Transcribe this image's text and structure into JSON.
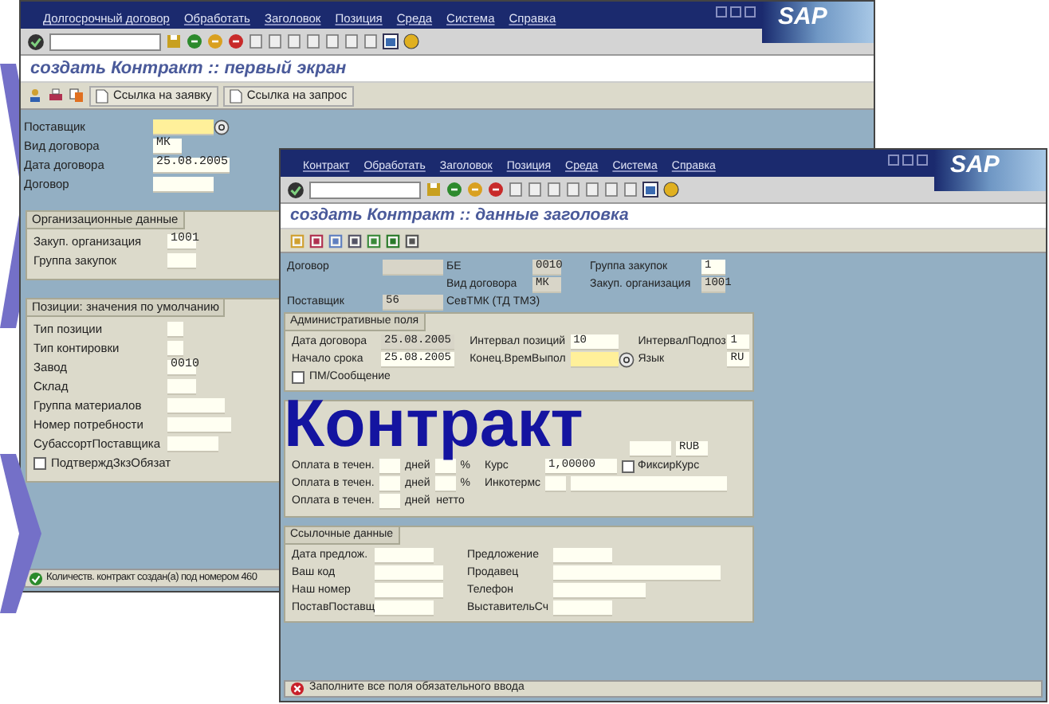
{
  "first_window": {
    "logo": "SAP",
    "menu": [
      "Долгосрочный договор",
      "Обработать",
      "Заголовок",
      "Позиция",
      "Среда",
      "Система",
      "Справка"
    ],
    "title": "создать Контракт :: первый экран",
    "app_buttons": [
      "Ссылка на заявку",
      "Ссылка на запрос"
    ],
    "header_fields": [
      {
        "label": "Поставщик",
        "kind": "required"
      },
      {
        "label": "Вид договора",
        "value": "МК",
        "kind": "input"
      },
      {
        "label": "Дата договора",
        "value": "25.08.2005",
        "kind": "input"
      },
      {
        "label": "Договор",
        "kind": "input"
      }
    ],
    "groups": [
      {
        "title": "Организационные данные",
        "fields": [
          {
            "label": "Закуп. организация",
            "value": "1001",
            "kind": "input"
          },
          {
            "label": "Группа закупок",
            "kind": "input"
          }
        ]
      },
      {
        "title": "Позиции: значения по умолчанию",
        "fields": [
          {
            "label": "Тип позиции",
            "kind": "input"
          },
          {
            "label": "Тип контировки",
            "kind": "input"
          },
          {
            "label": "Завод",
            "value": "0010",
            "kind": "input"
          },
          {
            "label": "Склад",
            "kind": "input"
          },
          {
            "label": "Группа материалов",
            "kind": "input"
          },
          {
            "label": "Номер потребности",
            "kind": "input"
          },
          {
            "label": "СубассортПоставщика",
            "kind": "input"
          }
        ],
        "checkbox": {
          "label": "ПодтверждЗкзОбязат",
          "checked": false
        }
      }
    ],
    "status": {
      "kind": "success",
      "text": "Количеств. контракт создан(а) под номером 460"
    }
  },
  "second_window": {
    "logo": "SAP",
    "menu": [
      "Контракт",
      "Обработать",
      "Заголовок",
      "Позиция",
      "Среда",
      "Система",
      "Справка"
    ],
    "title": "создать Контракт :: данные заголовка",
    "header_rows": [
      {
        "left": {
          "label": "Договор",
          "kind": "readonly"
        },
        "middle": {
          "label": "БЕ",
          "value": "0010",
          "kind": "readonly"
        },
        "right": {
          "label": "Группа закупок",
          "value": "1",
          "kind": "input"
        }
      },
      {
        "middle": {
          "label": "Вид договора",
          "value": "МК",
          "kind": "readonly"
        },
        "right": {
          "label": "Закуп. организация",
          "value": "1001",
          "kind": "readonly"
        }
      },
      {
        "left": {
          "label": "Поставщик",
          "value": "56",
          "kind": "readonly"
        },
        "middle": {
          "label": "СевТМК (ТД ТМЗ)",
          "kind": "text"
        }
      }
    ],
    "admin_group": {
      "title": "Административные поля",
      "rows": [
        [
          {
            "label": "Дата договора",
            "value": "25.08.2005",
            "kind": "readonly"
          },
          {
            "label": "Интервал позиций",
            "value": "10",
            "kind": "input"
          },
          {
            "label": "ИнтервалПодпоз",
            "value": "1",
            "kind": "input"
          }
        ],
        [
          {
            "label": "Начало срока",
            "value": "25.08.2005",
            "kind": "input"
          },
          {
            "label": "Конец.ВремВыпол",
            "kind": "required"
          },
          {
            "label": "Язык",
            "value": "RU",
            "kind": "input"
          }
        ]
      ],
      "checkbox": {
        "label": "ПМ/Сообщение",
        "checked": false
      }
    },
    "payment_group": {
      "currency_field": {
        "value": "RUB"
      },
      "rows": [
        [
          {
            "kind": "label",
            "text": "Оплата в течен."
          },
          {
            "kind": "field"
          },
          {
            "kind": "unit",
            "text": "дней"
          },
          {
            "kind": "field"
          },
          {
            "kind": "unit",
            "text": "%"
          },
          {
            "kind": "label_short",
            "text": "Курс"
          },
          {
            "kind": "field_wide",
            "value": "1,00000"
          },
          {
            "kind": "checkbox",
            "text": "ФиксирКурс",
            "checked": false
          }
        ],
        [
          {
            "kind": "label",
            "text": "Оплата в течен."
          },
          {
            "kind": "field"
          },
          {
            "kind": "unit",
            "text": "дней"
          },
          {
            "kind": "field"
          },
          {
            "kind": "unit",
            "text": "%"
          },
          {
            "kind": "label_short",
            "text": "Инкотермс"
          },
          {
            "kind": "field"
          },
          {
            "kind": "field_long"
          }
        ],
        [
          {
            "kind": "label",
            "text": "Оплата в течен."
          },
          {
            "kind": "field"
          },
          {
            "kind": "unit",
            "text": "дней  нетто"
          }
        ]
      ]
    },
    "reference_group": {
      "title": "Ссылочные данные",
      "rows": [
        [
          {
            "label": "Дата предлож."
          },
          {
            "label": "Предложение"
          }
        ],
        [
          {
            "label": "Ваш код"
          },
          {
            "label": "Продавец"
          }
        ],
        [
          {
            "label": "Наш номер"
          },
          {
            "label": "Телефон"
          }
        ],
        [
          {
            "label": "ПоставПоставщ"
          },
          {
            "label": "ВыставительСч"
          }
        ]
      ]
    },
    "status": {
      "kind": "error",
      "text": "Заполните все поля обязательного ввода"
    }
  },
  "overlay_title": "Контракт"
}
